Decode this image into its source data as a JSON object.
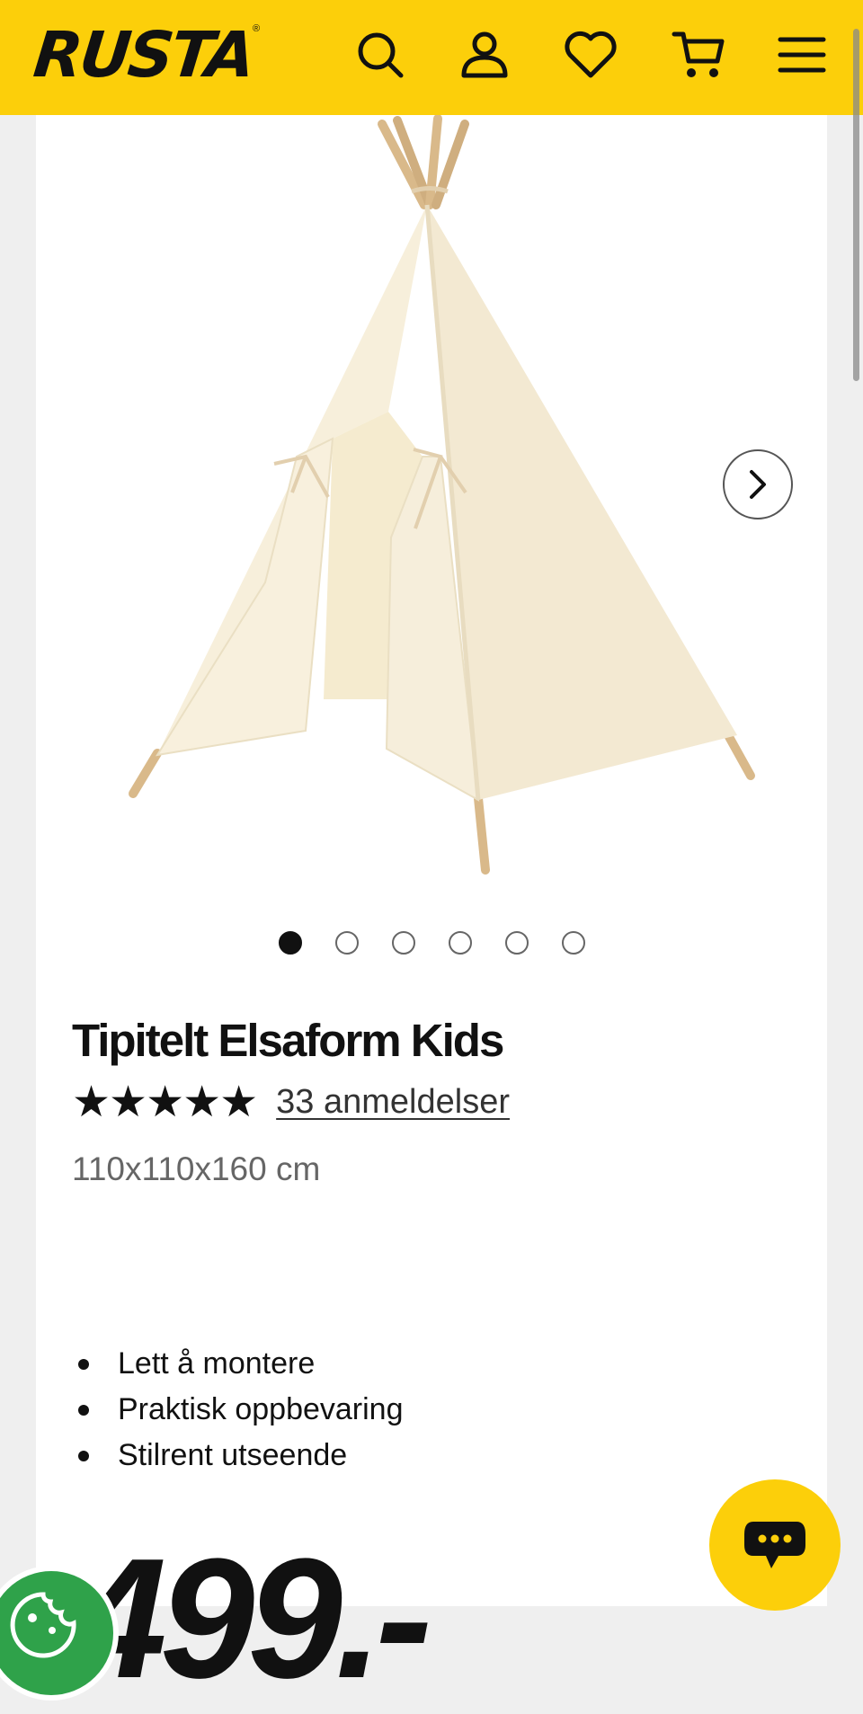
{
  "header": {
    "logo": "RUSTA",
    "logo_mark": "®",
    "icons": [
      "search-icon",
      "account-icon",
      "favorites-icon",
      "cart-icon",
      "menu-icon"
    ],
    "accent_color": "#fccf0a"
  },
  "gallery": {
    "image_alt": "tipi tent",
    "image_count": 6,
    "active_index": 0
  },
  "product": {
    "title": "Tipitelt Elsaform Kids",
    "stars": "★★★★★",
    "rating": 5,
    "reviews_label": "33 anmeldelser",
    "dimensions": "110x110x160 cm",
    "features": [
      "Lett å montere",
      "Praktisk oppbevaring",
      "Stilrent utseende"
    ],
    "price": "499.-"
  },
  "widgets": {
    "chat_icon": "chat-bubble-icon",
    "cookie_icon": "cookie-icon"
  }
}
